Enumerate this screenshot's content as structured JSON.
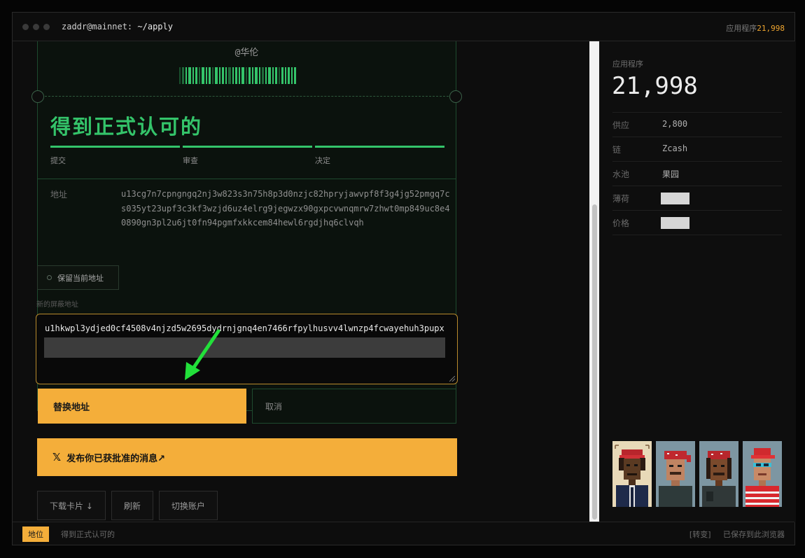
{
  "titlebar": {
    "user_host": "zaddr@mainnet:",
    "path": "~/apply",
    "app_label": "应用程序",
    "app_count": "21,998"
  },
  "card": {
    "handle": "@华伦",
    "status_title": "得到正式认可的",
    "steps": [
      {
        "label": "提交"
      },
      {
        "label": "审查"
      },
      {
        "label": "决定"
      }
    ],
    "address_label": "地址",
    "address_value": "u13cg7n7cpngngq2nj3w823s3n75h8p3d0nzjc82hpryjawvpf8f3g4jg52pmgq7cs035yt23upf3c3kf3wzjd6uz4elrg9jegwzx90gxpcvwnqmrw7zhwt0mp849uc8e40890gn3pl2u6jt0fn94pgmfxkkcem84hewl6rgdjhq6clvqh"
  },
  "keep_button": "保留当前地址",
  "new_address": {
    "label": "新的屏蔽地址",
    "value": "u1hkwpl3ydjed0cf4508v4njzd5w2695dydrnjgnq4en7466rfpylhusvv4lwnzp4fcwayehuh3pupx"
  },
  "replace_button": "替换地址",
  "cancel_button": "取消",
  "share_button": {
    "icon": "x-logo-icon",
    "glyph": "𝕏",
    "label": "发布你已获批准的消息↗"
  },
  "actions": {
    "download": "下载卡片 ↓",
    "refresh": "刷新",
    "switch": "切换账户"
  },
  "sidebar": {
    "app_label": "应用程序",
    "app_count": "21,998",
    "stats": [
      {
        "key": "供应",
        "value": "2,800"
      },
      {
        "key": "链",
        "value": "Zcash"
      },
      {
        "key": "水池",
        "value": "果园"
      },
      {
        "key": "薄荷",
        "value": ""
      },
      {
        "key": "价格",
        "value": ""
      }
    ]
  },
  "statusbar": {
    "badge": "地位",
    "status": "得到正式认可的",
    "toggle": "[转变]",
    "saved": "已保存到此浏览器"
  },
  "colors": {
    "accent": "#f4ae3a",
    "success": "#34c46a",
    "annotation_arrow": "#22e03a"
  }
}
